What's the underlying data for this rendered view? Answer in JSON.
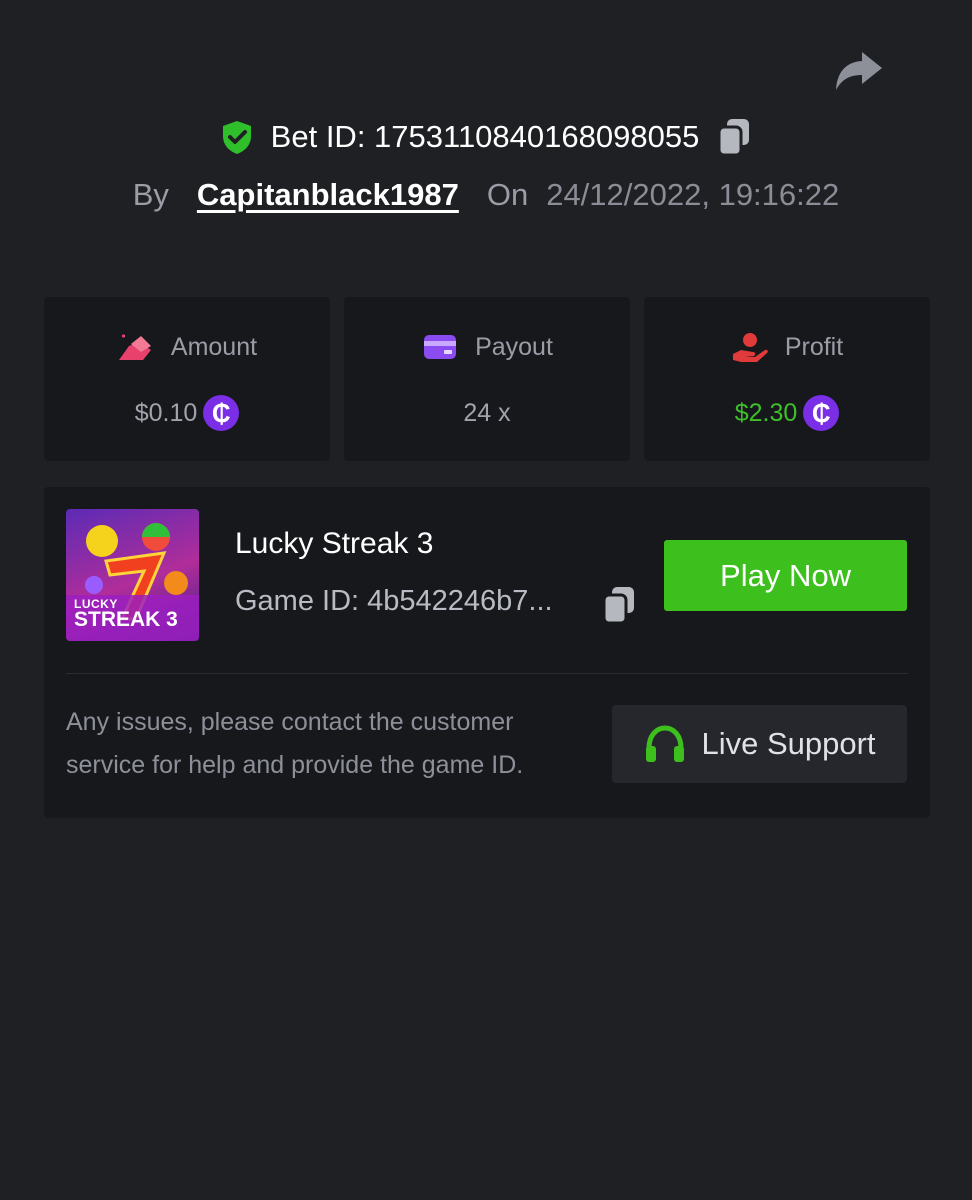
{
  "header": {
    "bet_id_label": "Bet ID: 1753110840168098055",
    "by_label": "By",
    "username": "Capitanblack1987",
    "on_label": "On",
    "datetime": "24/12/2022, 19:16:22"
  },
  "stats": {
    "amount": {
      "label": "Amount",
      "value": "$0.10",
      "icon": "bet-hand-icon"
    },
    "payout": {
      "label": "Payout",
      "value": "24 x",
      "icon": "wallet-card-icon"
    },
    "profit": {
      "label": "Profit",
      "value": "$2.30",
      "icon": "profit-hand-icon"
    }
  },
  "currency_symbol": "₵",
  "game": {
    "title": "Lucky Streak 3",
    "id_label": "Game ID: 4b542246b7...",
    "thumb_text_top": "LUCKY",
    "thumb_text_bottom": "STREAK 3",
    "play_label": "Play Now"
  },
  "support": {
    "help_text": "Any issues, please contact the customer service for help and provide the game ID.",
    "button_label": "Live Support"
  },
  "colors": {
    "background": "#1f2024",
    "card": "#17181c",
    "accent_green": "#3dbf1e",
    "profit_green": "#3fbf2a",
    "coin_purple": "#7a2ee6",
    "amount_pink": "#e8416b",
    "payout_purple": "#8a4bf0",
    "profit_red": "#e03a3a"
  }
}
